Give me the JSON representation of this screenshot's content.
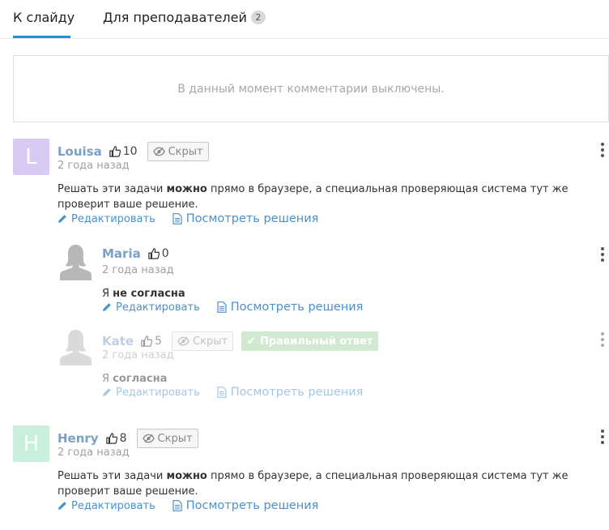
{
  "tabs": [
    {
      "label": "К слайду",
      "active": true
    },
    {
      "label": "Для преподавателей",
      "badge": "2"
    }
  ],
  "disabled_message": "В данный момент комментарии выключены.",
  "labels": {
    "hidden": "Скрыт",
    "correct": "Правильный ответ",
    "edit": "Редактировать",
    "view_solutions": "Посмотреть решения"
  },
  "comments": [
    {
      "author": "Louisa",
      "avatar_letter": "L",
      "avatar_color": "#d7cbf3",
      "likes": "10",
      "time": "2 года назад",
      "text_before": "Решать эти задачи ",
      "text_bold": "можно",
      "text_after": " прямо в браузере, а специальная проверяющая система тут же",
      "text_line2": "проверит ваше решение."
    },
    {
      "author": "Maria",
      "likes": "0",
      "time": "2 года назад",
      "text_before": "Я ",
      "text_bold": "не согласна"
    },
    {
      "author": "Kate",
      "likes": "5",
      "time": "2 года назад",
      "text_before": "Я ",
      "text_bold": "согласна"
    },
    {
      "author": "Henry",
      "avatar_letter": "H",
      "avatar_color": "#c8efdc",
      "likes": "8",
      "time": "2 года назад",
      "text_before": "Решать эти задачи ",
      "text_bold": "можно",
      "text_after": " прямо в браузере, а специальная проверяющая система тут же",
      "text_line2": "проверит ваше решение."
    }
  ],
  "colors": {
    "accent": "#2a8ed3",
    "author": "#7ba0c8",
    "link": "#4a90d0",
    "correct": "#a3d5a3"
  },
  "icons": [
    "thumbs-up-icon",
    "eye-slash-icon",
    "check-icon",
    "pencil-icon",
    "document-icon",
    "kebab-menu-icon",
    "user-silhouette-icon"
  ]
}
